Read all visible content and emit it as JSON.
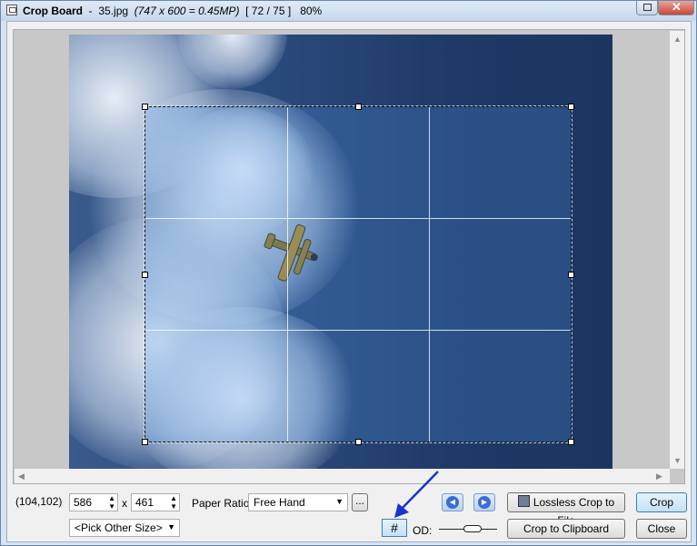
{
  "window": {
    "title_app": "Crop Board",
    "title_file": "35.jpg",
    "title_info": "(747 x 600 = 0.45MP)",
    "title_index": "[ 72 / 75 ]",
    "title_zoom": "80%"
  },
  "status": {
    "coords": "(104,102)"
  },
  "size": {
    "width": "586",
    "x_label": "x",
    "height": "461"
  },
  "paper_ratio": {
    "label": "Paper Ratio:",
    "value": "Free Hand",
    "more_label": "..."
  },
  "pick_size": {
    "value": "<Pick Other Size>"
  },
  "buttons": {
    "lossless": "Lossless Crop to File",
    "crop": "Crop",
    "clipboard": "Crop to Clipboard",
    "close": "Close"
  },
  "od": {
    "label": "OD:"
  },
  "grid_icon": "#"
}
